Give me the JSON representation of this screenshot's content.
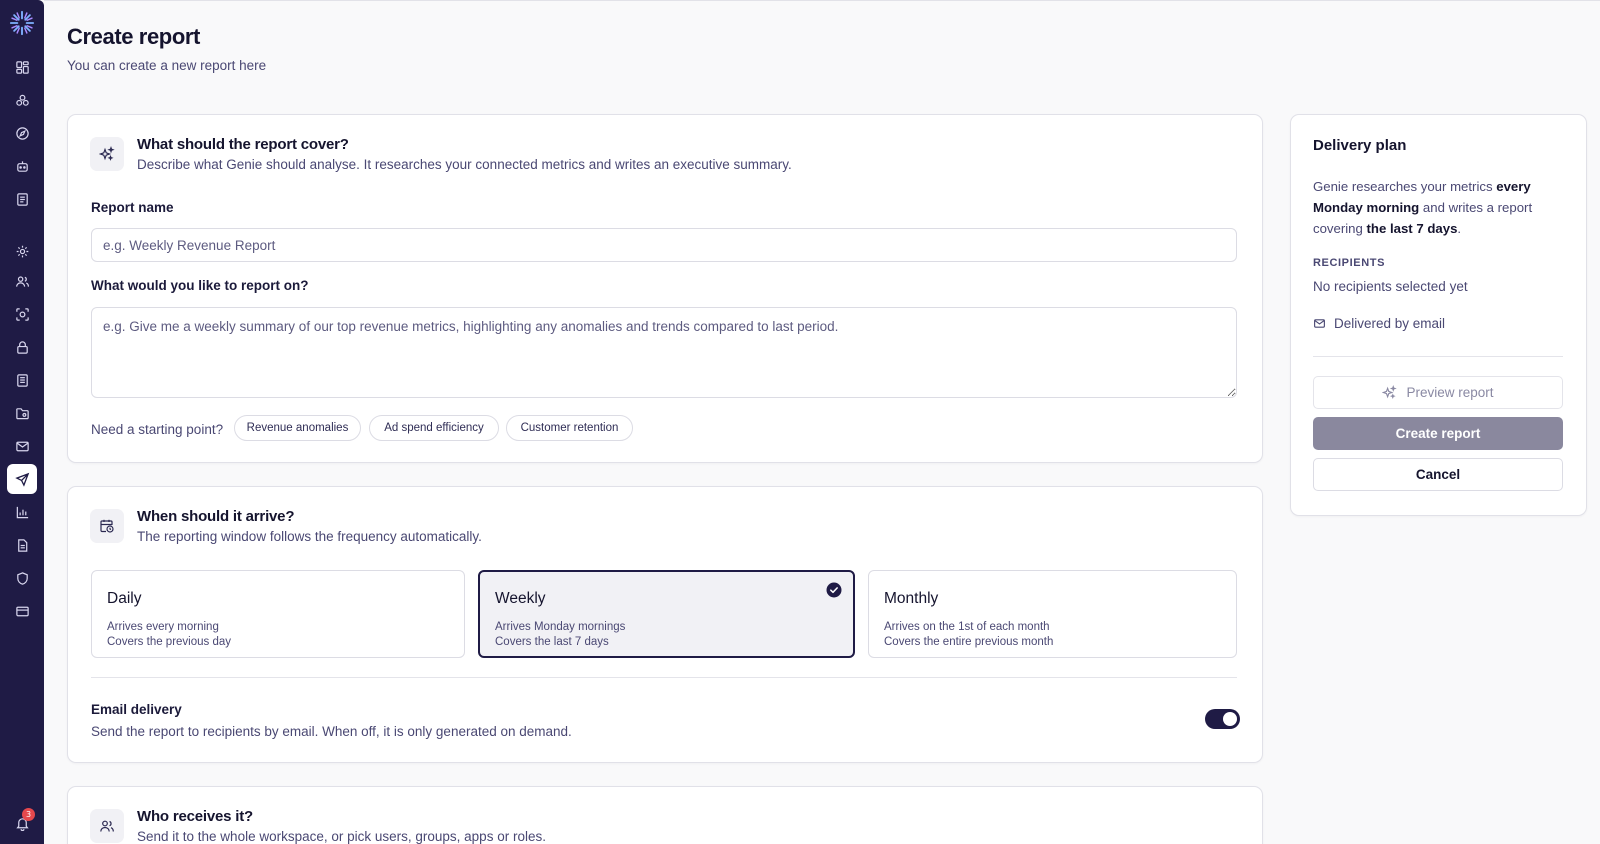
{
  "header": {
    "title": "Create report",
    "subtitle": "You can create a new report here"
  },
  "sidebar": {
    "active_item": "send",
    "notification_count": "3",
    "icons": [
      "dashboard-icon",
      "integrations-icon",
      "compass-icon",
      "bot-icon",
      "notebook-icon",
      "settings-icon",
      "users-icon",
      "scan-icon",
      "lock-icon",
      "book-icon",
      "folder-icon",
      "mail-icon",
      "send-icon",
      "bar-chart-icon",
      "document-icon",
      "shield-icon",
      "credit-card-icon",
      "bell-icon"
    ]
  },
  "cover": {
    "title": "What should the report cover?",
    "description": "Describe what Genie should analyse. It researches your connected metrics and writes an executive summary.",
    "name_label": "Report name",
    "name_placeholder": "e.g. Weekly Revenue Report",
    "name_value": "",
    "topic_label": "What would you like to report on?",
    "topic_placeholder": "e.g. Give me a weekly summary of our top revenue metrics, highlighting any anomalies and trends compared to last period.",
    "topic_value": "",
    "starting_point_label": "Need a starting point?",
    "suggestions": [
      "Revenue anomalies",
      "Ad spend efficiency",
      "Customer retention"
    ]
  },
  "schedule": {
    "title": "When should it arrive?",
    "description": "The reporting window follows the frequency automatically.",
    "selected": "Weekly",
    "options": [
      {
        "title": "Daily",
        "line1": "Arrives every morning",
        "line2": "Covers the previous day"
      },
      {
        "title": "Weekly",
        "line1": "Arrives Monday mornings",
        "line2": "Covers the last 7 days"
      },
      {
        "title": "Monthly",
        "line1": "Arrives on the 1st of each month",
        "line2": "Covers the entire previous month"
      }
    ],
    "email_title": "Email delivery",
    "email_description": "Send the report to recipients by email. When off, it is only generated on demand.",
    "email_enabled": true
  },
  "recipients": {
    "title": "Who receives it?",
    "description": "Send it to the whole workspace, or pick users, groups, apps or roles."
  },
  "plan": {
    "title": "Delivery plan",
    "text_1": "Genie researches your metrics ",
    "text_2": "every Monday morning",
    "text_3": " and writes a report covering ",
    "text_4": "the last 7 days",
    "text_5": ".",
    "recipients_label": "RECIPIENTS",
    "recipients_value": "No recipients selected yet",
    "delivery_method": "Delivered by email",
    "preview_button": "Preview report",
    "create_button": "Create report",
    "cancel_button": "Cancel"
  },
  "colors": {
    "sidebar": "#1f1b45",
    "accent": "#1f1b45",
    "create_disabled": "#8a889e",
    "notification": "#e5484d"
  }
}
